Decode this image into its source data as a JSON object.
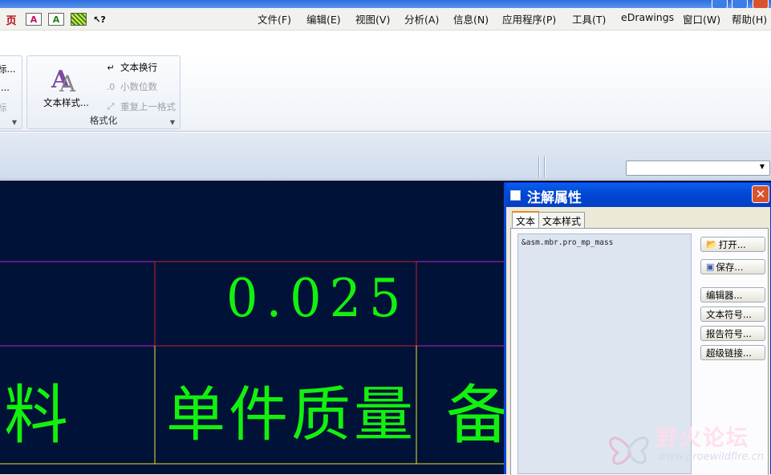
{
  "quick_icons": [
    {
      "name": "page-icon",
      "glyph": "页"
    },
    {
      "name": "text-style-a-icon",
      "glyph": "A"
    },
    {
      "name": "text-style-b-icon",
      "glyph": "A"
    },
    {
      "name": "hatch-icon",
      "glyph": ""
    },
    {
      "name": "help-pointer-icon",
      "glyph": "↖?"
    }
  ],
  "menu": [
    {
      "label": "文件",
      "key": "(F)"
    },
    {
      "label": "编辑",
      "key": "(E)"
    },
    {
      "label": "视图",
      "key": "(V)"
    },
    {
      "label": "分析",
      "key": "(A)"
    },
    {
      "label": "信息",
      "key": "(N)"
    },
    {
      "label": "应用程序",
      "key": "(P)"
    },
    {
      "label": "工具",
      "key": "(T)"
    },
    {
      "label": "eDrawings",
      "key": ""
    },
    {
      "label": "窗口",
      "key": "(W)"
    },
    {
      "label": "帮助",
      "key": "(H)"
    }
  ],
  "ribbon": {
    "left_group": {
      "items": [
        "标...",
        "...",
        "标"
      ]
    },
    "format_group": {
      "label": "格式化",
      "text_style_label": "文本样式...",
      "wrap_label": "文本换行",
      "decimal_label": "小数位数",
      "repeat_label": "重复上一格式"
    }
  },
  "canvas": {
    "value_text": "0.025",
    "header_left": "料",
    "header_mid": "单件质量",
    "header_right": "备"
  },
  "dialog": {
    "title": "注解属性",
    "close_glyph": "✕",
    "tabs": [
      "文本",
      "文本样式"
    ],
    "active_tab": "文本",
    "text_content": "&asm.mbr.pro_mp_mass",
    "buttons": {
      "open": "打开...",
      "save": "保存...",
      "editor": "编辑器...",
      "text_symbol": "文本符号...",
      "report_symbol": "报告符号...",
      "hyperlink": "超级链接..."
    }
  },
  "watermark": {
    "name": "野火论坛",
    "url": "www.proewildfire.cn"
  },
  "colors": {
    "canvas_bg": "#001237",
    "cad_text": "#13f00f",
    "line_red": "#c81e2a",
    "line_magenta": "#c020c8",
    "line_yellow": "#e6e62a"
  }
}
